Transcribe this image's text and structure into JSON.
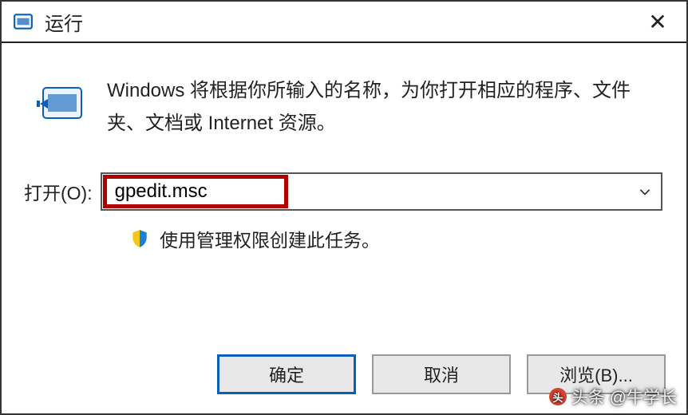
{
  "titlebar": {
    "title": "运行",
    "close_label": "✕"
  },
  "content": {
    "description": "Windows 将根据你所输入的名称，为你打开相应的程序、文件夹、文档或 Internet 资源。",
    "open_label": "打开(O):",
    "input_value": "gpedit.msc",
    "admin_note": "使用管理权限创建此任务。"
  },
  "buttons": {
    "ok": "确定",
    "cancel": "取消",
    "browse": "浏览(B)..."
  },
  "watermark": {
    "text": "头条 @牛学长"
  }
}
